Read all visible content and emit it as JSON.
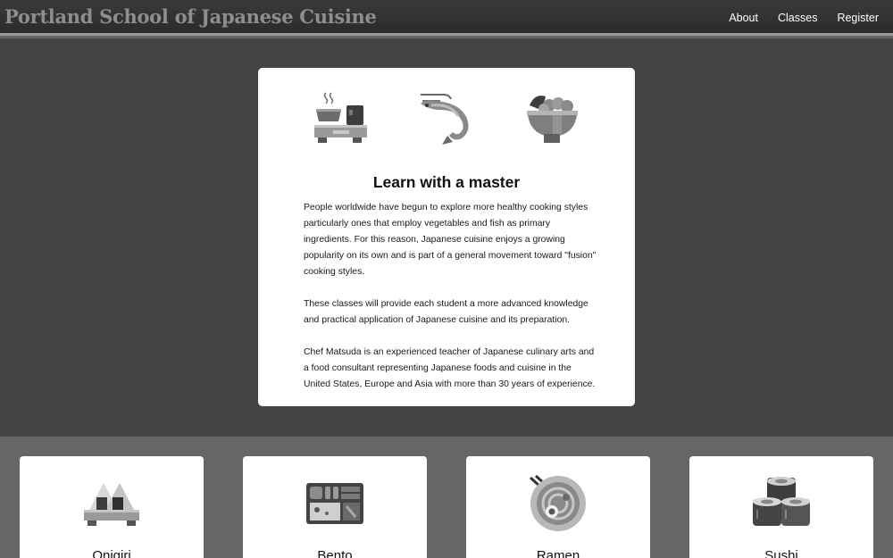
{
  "header": {
    "title": "Portland School of Japanese Cuisine",
    "nav": [
      {
        "label": "About"
      },
      {
        "label": "Classes"
      },
      {
        "label": "Register"
      }
    ]
  },
  "hero": {
    "icons": [
      "tea-set-icon",
      "shrimp-icon",
      "rice-bowl-icon"
    ],
    "title": "Learn with a master",
    "paragraphs": [
      "People worldwide have begun to explore more healthy cooking styles particularly ones that employ vegetables and fish as primary ingredients. For this reason, Japanese cuisine enjoys a growing popularity on its own and is part of a general movement toward \"fusion\" cooking styles.",
      "These classes will provide each student a more advanced knowledge and practical application of Japanese cuisine and its preparation.",
      "Chef Matsuda is an experienced teacher of Japanese culinary arts and a food consultant representing Japanese foods and cuisine in the United States, Europe and Asia with more than 30 years of experience."
    ]
  },
  "classes": [
    {
      "label": "Onigiri",
      "icon": "onigiri-icon"
    },
    {
      "label": "Bento",
      "icon": "bento-box-icon"
    },
    {
      "label": "Ramen",
      "icon": "ramen-bowl-icon"
    },
    {
      "label": "Sushi",
      "icon": "sushi-rolls-icon"
    }
  ]
}
